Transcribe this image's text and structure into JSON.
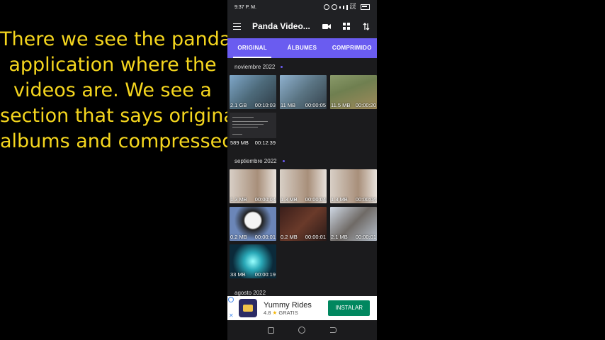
{
  "caption": {
    "lines": [
      "There we see the panda",
      "application where the",
      "videos are. We see a",
      "section that says original,",
      "albums and compressed."
    ]
  },
  "status_bar": {
    "time": "9:37 P. M.",
    "data_speed": "212 K/S"
  },
  "app_bar": {
    "title": "Panda Video...",
    "actions": [
      "camera-icon",
      "grid-view-icon",
      "sort-icon"
    ]
  },
  "tabs": [
    "ORIGINAL",
    "ÁLBUMES",
    "COMPRIMIDO"
  ],
  "active_tab": "ORIGINAL",
  "sections": [
    {
      "date": "noviembre 2022",
      "videos": [
        {
          "size": "2.1 GB",
          "duration": "00:10:03"
        },
        {
          "size": "11 MB",
          "duration": "00:00:05"
        },
        {
          "size": "11.5 MB",
          "duration": "00:00:20"
        },
        {
          "size": "589 MB",
          "duration": "00:12:39"
        }
      ]
    },
    {
      "date": "septiembre 2022",
      "videos": [
        {
          "size": "1.3 MB",
          "duration": "00:00:04"
        },
        {
          "size": "1.3 MB",
          "duration": "00:00:04"
        },
        {
          "size": "1.3 MB",
          "duration": "00:00:04"
        },
        {
          "size": "0.2 MB",
          "duration": "00:00:01"
        },
        {
          "size": "0.2 MB",
          "duration": "00:00:01"
        },
        {
          "size": "2.1 MB",
          "duration": "00:00:01"
        },
        {
          "size": "33 MB",
          "duration": "00:00:19"
        }
      ]
    },
    {
      "date": "agosto 2022"
    }
  ],
  "ad": {
    "name": "Yummy Rides",
    "rating": "4.8",
    "price": "GRATIS",
    "button": "INSTALAR"
  },
  "colors": {
    "accent": "#6a5cf0",
    "caption": "#f5d61e",
    "install": "#01875f"
  }
}
